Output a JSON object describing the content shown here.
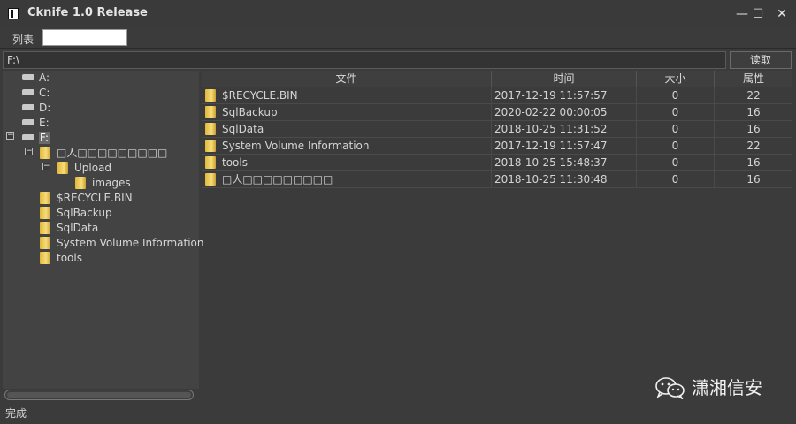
{
  "window": {
    "title": "Cknife 1.0 Release",
    "minimize": "—",
    "maximize": "☐",
    "close": "✕"
  },
  "tab": {
    "label": "列表"
  },
  "path_bar": {
    "value": "F:\\",
    "read_button": "读取"
  },
  "tree": {
    "drives": [
      "A:",
      "C:",
      "D:",
      "E:",
      "F:"
    ],
    "folder_cjk": "□人□□□□□□□□□",
    "upload": "Upload",
    "images": "images",
    "recycle": "$RECYCLE.BIN",
    "sqlbackup": "SqlBackup",
    "sqldata": "SqlData",
    "sysvol": "System Volume Information",
    "tools": "tools",
    "expander_minus": "−"
  },
  "table": {
    "headers": [
      "文件",
      "时间",
      "大小",
      "属性"
    ],
    "rows": [
      {
        "name": "$RECYCLE.BIN",
        "time": "2017-12-19 11:57:57",
        "size": "0",
        "attr": "22"
      },
      {
        "name": "SqlBackup",
        "time": "2020-02-22 00:00:05",
        "size": "0",
        "attr": "16"
      },
      {
        "name": "SqlData",
        "time": "2018-10-25 11:31:52",
        "size": "0",
        "attr": "16"
      },
      {
        "name": "System Volume Information",
        "time": "2017-12-19 11:57:47",
        "size": "0",
        "attr": "22"
      },
      {
        "name": "tools",
        "time": "2018-10-25 15:48:37",
        "size": "0",
        "attr": "16"
      },
      {
        "name": "□人□□□□□□□□□",
        "time": "2018-10-25 11:30:48",
        "size": "0",
        "attr": "16"
      }
    ]
  },
  "status": {
    "text": "完成"
  },
  "watermark": {
    "text": "潇湘信安",
    "icon": "wechat-icon"
  }
}
